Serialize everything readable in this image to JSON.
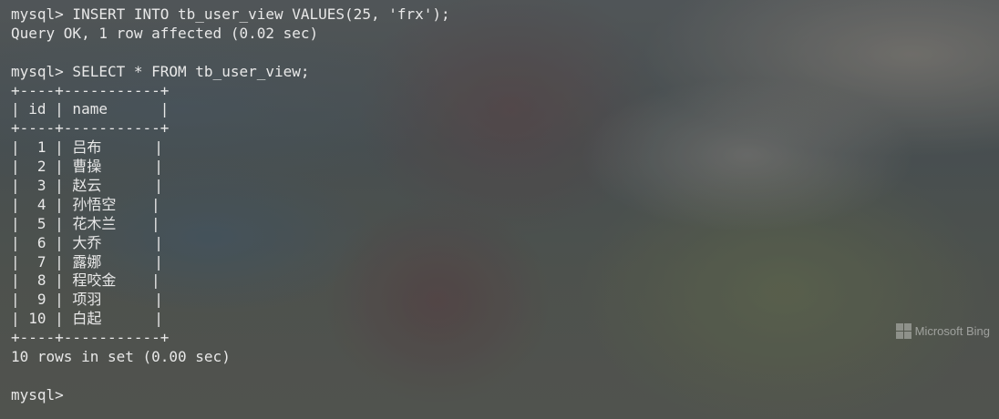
{
  "terminal": {
    "lines": [
      "mysql> INSERT INTO tb_user_view VALUES(25, 'frx');",
      "Query OK, 1 row affected (0.02 sec)",
      "",
      "mysql> SELECT * FROM tb_user_view;",
      "+----+-----------+",
      "| id | name      |",
      "+----+-----------+",
      "|  1 | 吕布      |",
      "|  2 | 曹操      |",
      "|  3 | 赵云      |",
      "|  4 | 孙悟空    |",
      "|  5 | 花木兰    |",
      "|  6 | 大乔      |",
      "|  7 | 露娜      |",
      "|  8 | 程咬金    |",
      "|  9 | 项羽      |",
      "| 10 | 白起      |",
      "+----+-----------+",
      "10 rows in set (0.00 sec)",
      "",
      "mysql>"
    ]
  },
  "watermark": {
    "text": "Microsoft Bing",
    "icon": "windows-logo-icon"
  }
}
